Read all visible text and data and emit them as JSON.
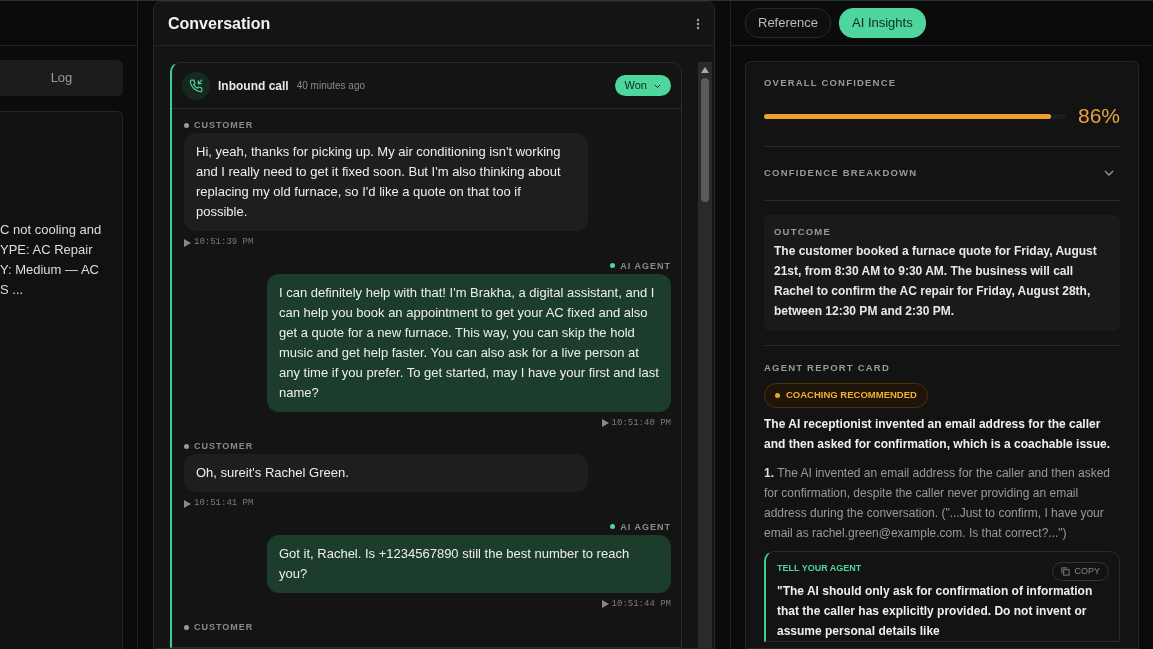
{
  "left_panel": {
    "log_button": "Log",
    "summary_lines": [
      "C not cooling and",
      "YPE: AC Repair",
      "Y: Medium — AC",
      "S ..."
    ]
  },
  "conversation": {
    "title": "Conversation",
    "call": {
      "title": "Inbound call",
      "time_ago": "40 minutes ago",
      "status": "Won"
    },
    "messages": [
      {
        "kind": "customer",
        "label": "CUSTOMER",
        "text": "Hi, yeah, thanks for picking up. My air conditioning isn't working and I really need to get it fixed soon. But I'm also thinking about replacing my old furnace, so I'd like a quote on that too if possible.",
        "time": "10:51:39 PM"
      },
      {
        "kind": "agent",
        "label": "AI AGENT",
        "text": "I can definitely help with that! I'm Brakha, a digital assistant, and I can help you book an appointment to get your AC fixed and also get a quote for a new furnace. This way, you can skip the hold music and get help faster. You can also ask for a live person at any time if you prefer. To get started, may I have your first and last name?",
        "time": "10:51:40 PM"
      },
      {
        "kind": "customer",
        "label": "CUSTOMER",
        "text": "Oh, sureit's Rachel Green.",
        "time": "10:51:41 PM"
      },
      {
        "kind": "agent",
        "label": "AI AGENT",
        "text": "Got it, Rachel. Is +1234567890 still the best number to reach you?",
        "time": "10:51:44 PM"
      },
      {
        "kind": "customer",
        "label": "CUSTOMER"
      }
    ]
  },
  "insights": {
    "tabs": [
      {
        "label": "Reference",
        "selected": false
      },
      {
        "label": "AI Insights",
        "selected": true
      }
    ],
    "confidence": {
      "label": "OVERALL CONFIDENCE",
      "level": 0.95,
      "reading": "86%"
    },
    "breakdown": {
      "label": "CONFIDENCE BREAKDOWN",
      "expanded": false
    },
    "outcome": {
      "label": "OUTCOME",
      "text": "The customer booked a furnace quote for Friday, August 21st, from 8:30 AM to 9:30 AM. The business will call Rachel to confirm the AC repair for Friday, August 28th, between 12:30 PM and 2:30 PM."
    },
    "report_card": {
      "label": "AGENT REPORT CARD",
      "badge": "COACHING RECOMMENDED",
      "summary": "The AI receptionist invented an email address for the caller and then asked for confirmation, which is a coachable issue.",
      "issues": [
        "**1.** The AI invented an email address for the caller and then asked for confirmation, despite the caller never providing an email address during the conversation. (\"...Just to confirm, I have your email as rachel.green@example.com. Is that correct?...\")"
      ],
      "tell_agent": {
        "label": "TELL YOUR AGENT",
        "copy": "COPY",
        "text": "\"The AI should only ask for confirmation of information that the caller has explicitly provided. Do not invent or assume personal details like"
      }
    }
  }
}
